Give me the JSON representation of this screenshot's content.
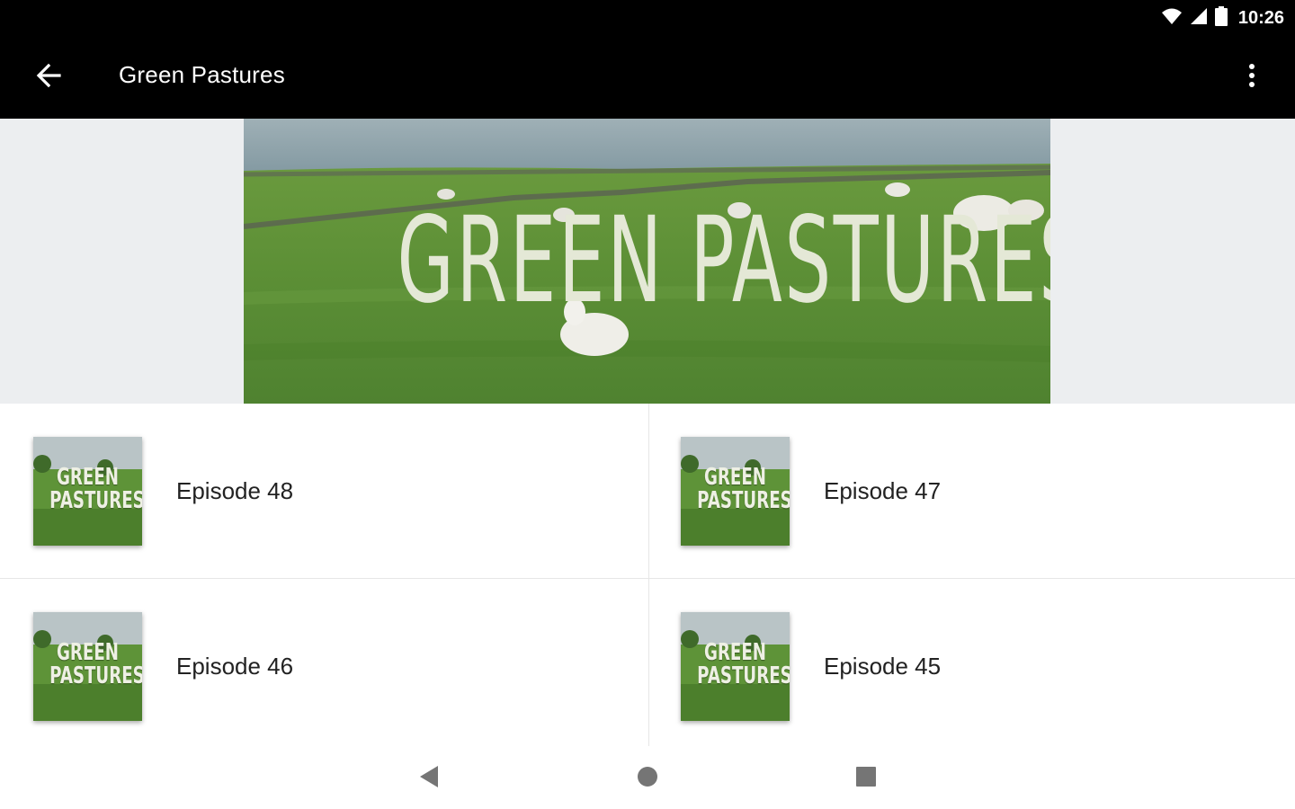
{
  "status_bar": {
    "time": "10:26",
    "icons": [
      "wifi-icon",
      "cellular-signal-icon",
      "battery-icon"
    ]
  },
  "app_bar": {
    "back_icon": "arrow-back-icon",
    "title": "Green Pastures",
    "overflow_icon": "more-vert-icon"
  },
  "banner": {
    "title_text": "GREEN PASTURES"
  },
  "thumbnail": {
    "line1": "GREEN",
    "line2": "PASTURES"
  },
  "episodes": [
    {
      "title": "Episode 48"
    },
    {
      "title": "Episode 47"
    },
    {
      "title": "Episode 46"
    },
    {
      "title": "Episode 45"
    }
  ],
  "nav_bar": {
    "icons": [
      "nav-back-icon",
      "nav-home-icon",
      "nav-recents-icon"
    ]
  },
  "colors": {
    "app_bar": "#000000",
    "banner_background": "#eceef0",
    "grass": "#5d8f36",
    "sea": "#8ea3ab",
    "banner_text": "#e4e8d6"
  }
}
